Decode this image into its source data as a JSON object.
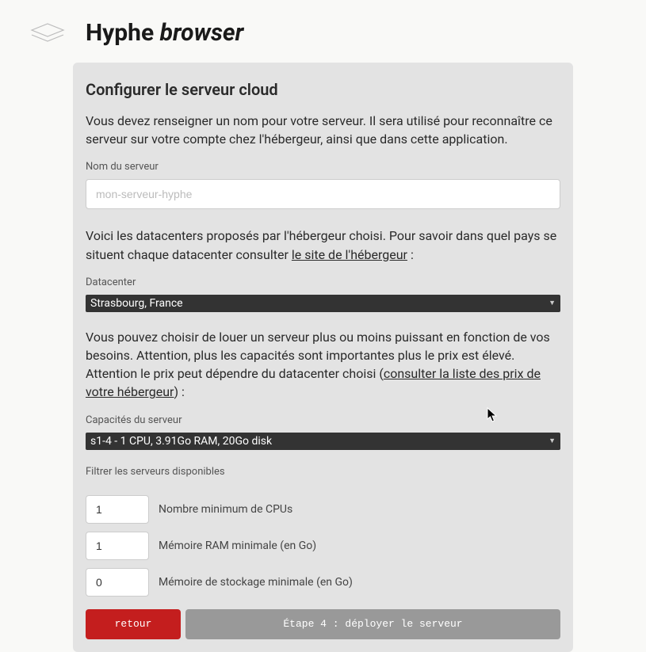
{
  "header": {
    "title_part1": "Hyphe ",
    "title_part2": "browser"
  },
  "panel": {
    "title": "Configurer le serveur cloud",
    "intro_text": "Vous devez renseigner un nom pour votre serveur. Il sera utilisé pour reconnaître ce serveur sur votre compte chez l'hébergeur, ainsi que dans cette application.",
    "server_name": {
      "label": "Nom du serveur",
      "placeholder": "mon-serveur-hyphe",
      "value": ""
    },
    "datacenter_intro_part1": "Voici les datacenters proposés par l'hébergeur choisi. Pour savoir dans quel pays se situent chaque datacenter consulter ",
    "datacenter_intro_link": "le site de l'hébergeur",
    "datacenter_intro_part2": " :",
    "datacenter": {
      "label": "Datacenter",
      "selected": "Strasbourg, France"
    },
    "capacity_intro_part1": "Vous pouvez choisir de louer un serveur plus ou moins puissant en fonction de vos besoins. Attention, plus les capacités sont importantes plus le prix est élevé. Attention le prix peut dépendre du datacenter choisi (",
    "capacity_intro_link": "consulter la liste des prix de votre hébergeur",
    "capacity_intro_part2": ") :",
    "capacity": {
      "label": "Capacités du serveur",
      "selected": "s1-4 - 1 CPU, 3.91Go RAM, 20Go disk"
    },
    "filter": {
      "label": "Filtrer les serveurs disponibles",
      "cpu": {
        "value": "1",
        "label": "Nombre minimum de CPUs"
      },
      "ram": {
        "value": "1",
        "label": "Mémoire RAM minimale (en Go)"
      },
      "disk": {
        "value": "0",
        "label": "Mémoire de stockage minimale (en Go)"
      }
    },
    "buttons": {
      "back": "retour",
      "next": "Étape 4 : déployer le serveur"
    }
  }
}
